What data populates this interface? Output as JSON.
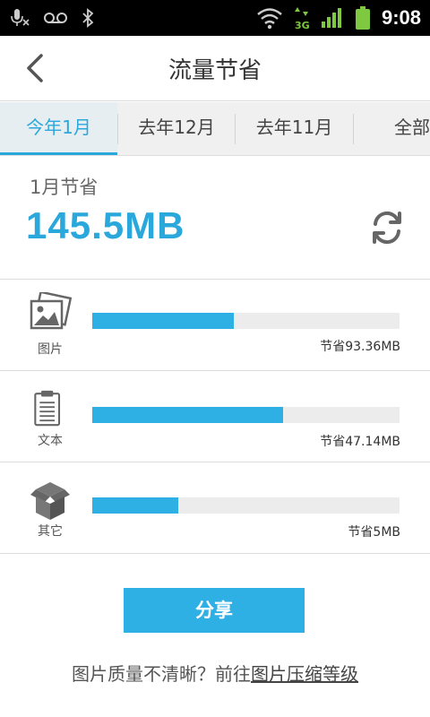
{
  "status_bar": {
    "time": "9:08",
    "network": "3G",
    "icons": [
      "mic-mute-icon",
      "voicemail-icon",
      "bluetooth-icon",
      "wifi-icon",
      "3g-data-icon",
      "signal-icon",
      "battery-icon"
    ]
  },
  "header": {
    "title": "流量节省"
  },
  "tabs": [
    {
      "label": "今年1月",
      "active": true
    },
    {
      "label": "去年12月",
      "active": false
    },
    {
      "label": "去年11月",
      "active": false
    },
    {
      "label": "全部",
      "active": false
    }
  ],
  "summary": {
    "label": "1月节省",
    "value": "145.5MB"
  },
  "categories": [
    {
      "name": "图片",
      "amount": "节省93.36MB",
      "progress": 0.46,
      "icon": "image-icon"
    },
    {
      "name": "文本",
      "amount": "节省47.14MB",
      "progress": 0.62,
      "icon": "document-icon"
    },
    {
      "name": "其它",
      "amount": "节省5MB",
      "progress": 0.28,
      "icon": "box-icon"
    }
  ],
  "share_label": "分享",
  "footer": {
    "text": "图片质量不清晰？前往",
    "link": "图片压缩等级"
  },
  "colors": {
    "accent": "#2aa8dc",
    "bar": "#2fb0e4"
  }
}
